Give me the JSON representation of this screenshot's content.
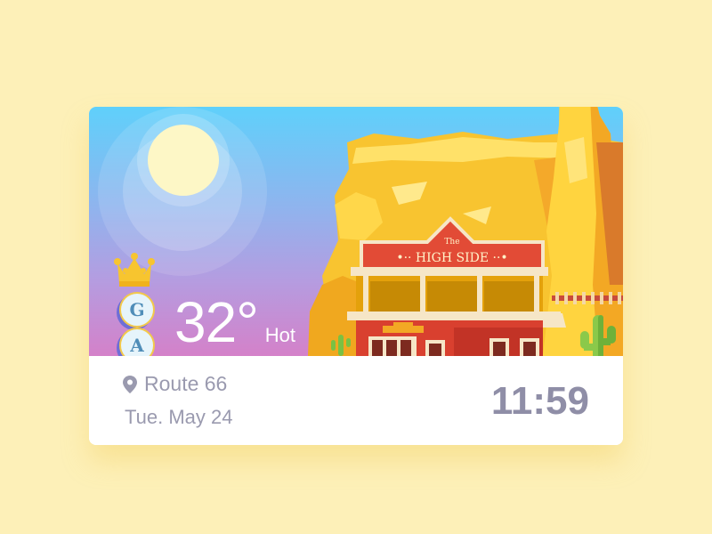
{
  "weather": {
    "temperature": "32°",
    "condition": "Hot"
  },
  "badges": [
    {
      "letter": "G"
    },
    {
      "letter": "A"
    }
  ],
  "building": {
    "sign_top": "The",
    "sign_main": "•·· HIGH SIDE ··•"
  },
  "location": {
    "name": "Route 66",
    "icon": "map-pin-icon"
  },
  "date": "Tue. May 24",
  "time": "11:59",
  "colors": {
    "background": "#fdf0b8",
    "sky_top": "#5fd0fb",
    "sky_bottom": "#d481c9",
    "text_muted": "#9a9aaf"
  }
}
